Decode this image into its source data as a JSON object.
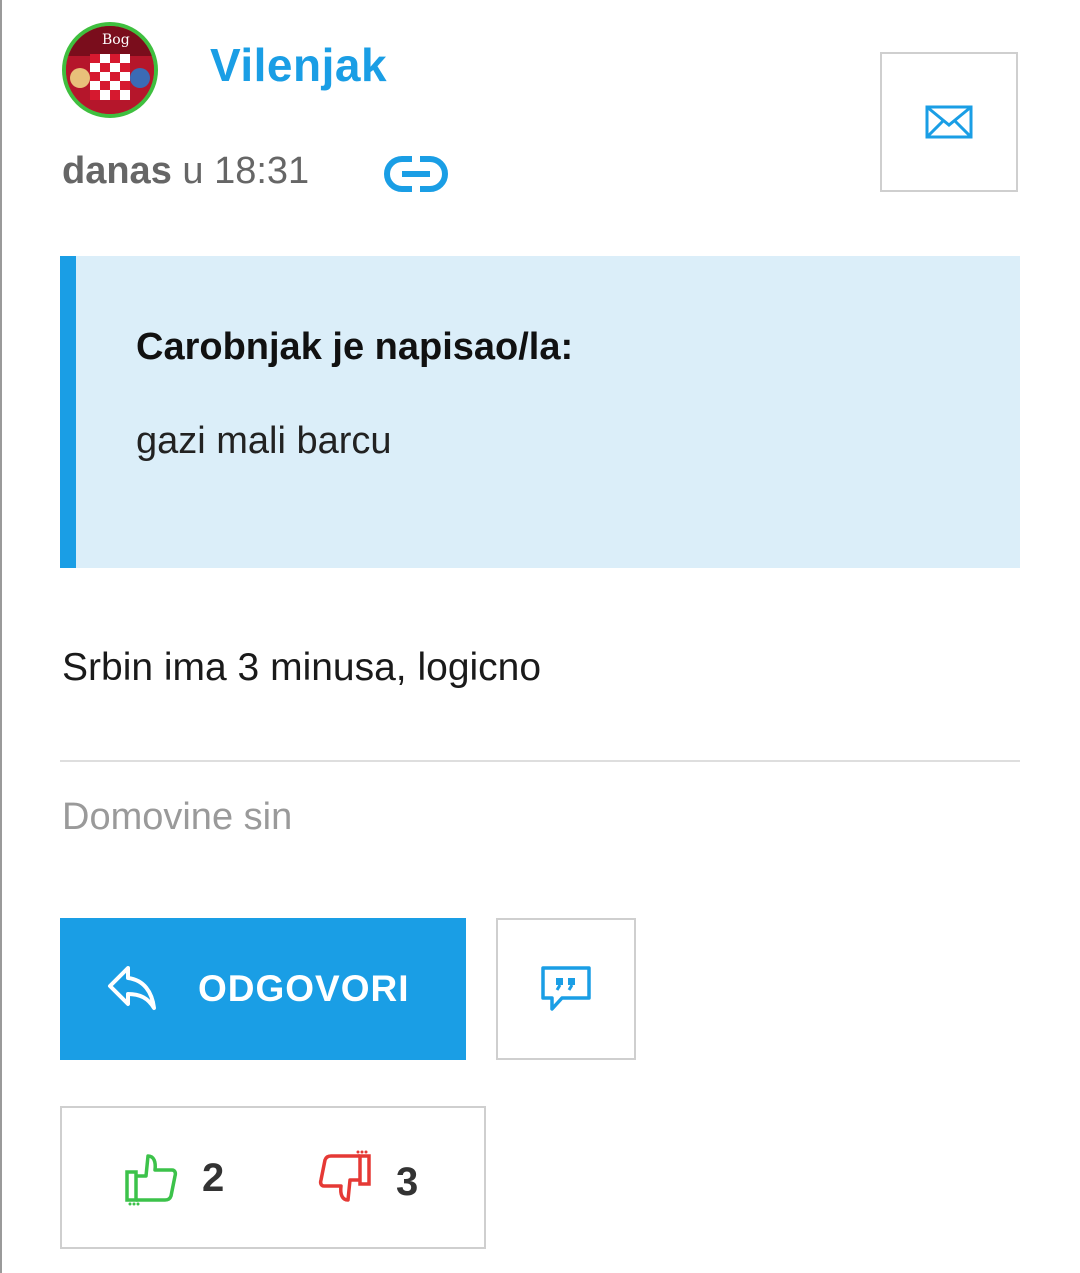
{
  "post": {
    "author": "Vilenjak",
    "timestamp_day": "danas",
    "timestamp_rest": " u 18:31",
    "avatar_text": "Bog",
    "quote": {
      "author_line": "Carobnjak je napisao/la:",
      "text": "gazi mali barcu"
    },
    "body": "Srbin ima 3 minusa, logicno",
    "signature": "Domovine sin"
  },
  "actions": {
    "reply_label": "ODGOVORI",
    "icons": {
      "mail": "envelope-icon",
      "link": "link-icon",
      "reply": "reply-arrow-icon",
      "quote": "quote-bubble-icon",
      "vote_up": "thumbs-up-icon",
      "vote_down": "thumbs-down-icon"
    }
  },
  "votes": {
    "up": "2",
    "down": "3"
  },
  "colors": {
    "accent": "#1a9ee5",
    "quote_bg": "#dbeef9",
    "vote_up": "#3cc24a",
    "vote_down": "#e53935",
    "avatar_ring": "#3fbf3f"
  }
}
